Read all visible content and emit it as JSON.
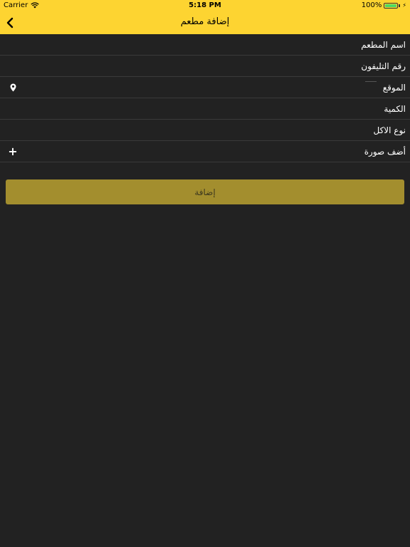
{
  "status_bar": {
    "carrier": "Carrier",
    "time": "5:18 PM",
    "battery_percent": "100%",
    "battery_level": 1.0
  },
  "nav": {
    "title": "إضافة مطعم",
    "back_icon": "chevron-left-icon"
  },
  "form": {
    "restaurant_name": "اسم المطعم",
    "phone": "رقم التليفون",
    "location": "الموقع",
    "quantity": "الكمية",
    "food_type": "نوع الاكل",
    "add_photo": "أضف صورة",
    "location_icon": "map-pin-icon",
    "add_photo_icon": "plus-icon"
  },
  "submit_label": "إضافة",
  "colors": {
    "header": "#fdd431",
    "background": "#222222",
    "button": "#a38e2e",
    "divider": "#3a3a3a"
  }
}
